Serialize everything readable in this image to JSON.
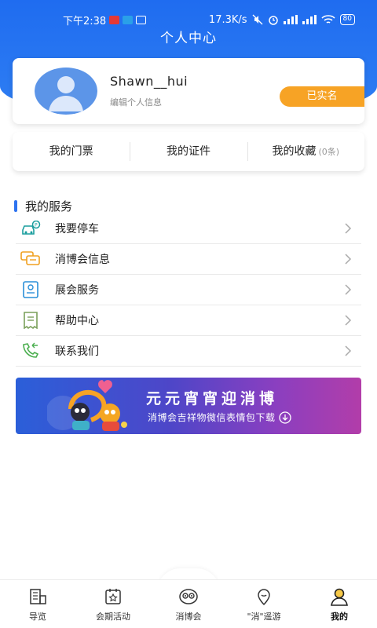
{
  "status_bar": {
    "time": "下午2:38",
    "network_speed": "17.3K/s",
    "battery": "80"
  },
  "page": {
    "title": "个人中心"
  },
  "profile": {
    "username": "Shawn__hui",
    "edit_link": "编辑个人信息",
    "verified_badge": "已实名"
  },
  "tabs": [
    {
      "label": "我的门票"
    },
    {
      "label": "我的证件"
    },
    {
      "label": "我的收藏",
      "count": "(0条)"
    }
  ],
  "services": {
    "title": "我的服务",
    "items": [
      {
        "label": "我要停车",
        "icon": "parking-car-icon"
      },
      {
        "label": "消博会信息",
        "icon": "chat-bubbles-icon"
      },
      {
        "label": "展会服务",
        "icon": "document-badge-icon"
      },
      {
        "label": "帮助中心",
        "icon": "receipt-icon"
      },
      {
        "label": "联系我们",
        "icon": "phone-call-icon"
      }
    ]
  },
  "banner": {
    "title": "元元宵宵迎消博",
    "subtitle": "消博会吉祥物微信表情包下载"
  },
  "bottom_nav": {
    "items": [
      {
        "label": "导览",
        "icon": "map-building-icon"
      },
      {
        "label": "会期活动",
        "icon": "calendar-star-icon"
      },
      {
        "label": "消博会",
        "icon": "mascot-face-icon"
      },
      {
        "label": "\"消\"遥游",
        "icon": "location-pin-icon"
      },
      {
        "label": "我的",
        "icon": "user-profile-icon",
        "active": true
      }
    ]
  },
  "colors": {
    "header_blue": "#1f6cf0",
    "badge_orange": "#f7a325",
    "accent_blue": "#2d73f0",
    "icon_teal": "#1a9e9e",
    "icon_orange": "#f0a020"
  }
}
